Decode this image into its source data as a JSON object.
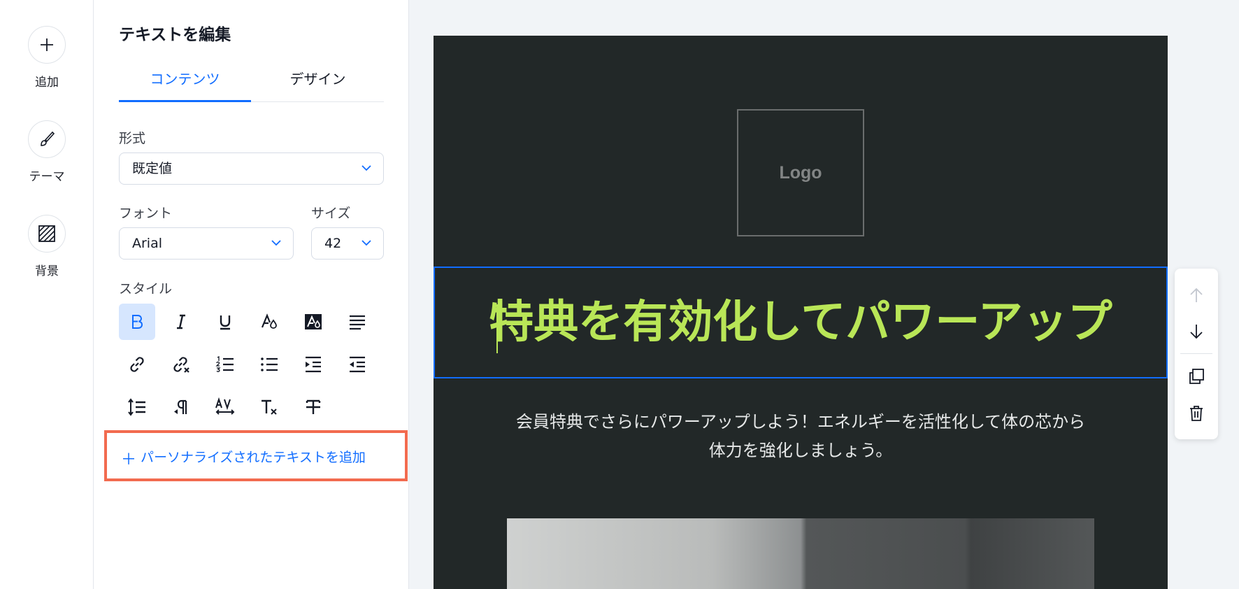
{
  "rail": {
    "items": [
      {
        "label": "追加",
        "icon": "plus-icon"
      },
      {
        "label": "テーマ",
        "icon": "brush-icon"
      },
      {
        "label": "背景",
        "icon": "background-hatch-icon"
      }
    ]
  },
  "panel": {
    "title": "テキストを編集",
    "tabs": [
      {
        "label": "コンテンツ",
        "active": true
      },
      {
        "label": "デザイン",
        "active": false
      }
    ],
    "format": {
      "label": "形式",
      "value": "既定値"
    },
    "font": {
      "label": "フォント",
      "value": "Arial"
    },
    "size": {
      "label": "サイズ",
      "value": "42"
    },
    "style": {
      "label": "スタイル",
      "buttons": [
        "bold-icon",
        "italic-icon",
        "underline-icon",
        "text-color-icon",
        "highlight-color-icon",
        "align-icon",
        "link-icon",
        "unlink-icon",
        "numbered-list-icon",
        "bulleted-list-icon",
        "indent-icon",
        "outdent-icon",
        "line-height-icon",
        "text-direction-icon",
        "letter-spacing-icon",
        "clear-format-icon",
        "strikethrough-icon"
      ]
    },
    "add_personalized": "パーソナライズされたテキストを追加"
  },
  "canvas": {
    "logo": "Logo",
    "headline": "特典を有効化してパワーアップ",
    "body_line1": "会員特典でさらにパワーアップしよう！エネルギーを活性化して体の芯から",
    "body_line2": "体力を強化しましょう。"
  },
  "colors": {
    "accent": "#116dff",
    "headline": "#b9e657",
    "email_bg": "#222828",
    "highlight_border": "#f26b4f"
  }
}
